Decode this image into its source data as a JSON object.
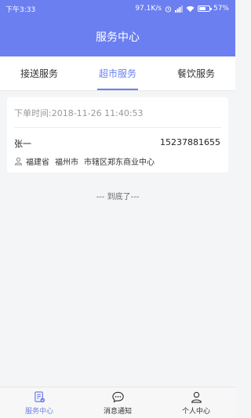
{
  "statusbar": {
    "time": "下午3:33",
    "network_speed": "97.1K/s",
    "battery": "57%",
    "battery_level": 0.57
  },
  "header": {
    "title": "服务中心"
  },
  "tabs": [
    {
      "label": "接送服务",
      "active": false
    },
    {
      "label": "超市服务",
      "active": true
    },
    {
      "label": "餐饮服务",
      "active": false
    }
  ],
  "order": {
    "time_label": "下单时间:2018-11-26 11:40:53",
    "name": "张一",
    "phone": "15237881655",
    "address": {
      "province": "福建省",
      "city": "福州市",
      "district_detail": "市辖区郑东商业中心"
    }
  },
  "list_end_text": "--- 到底了---",
  "bottom_nav": [
    {
      "label": "服务中心",
      "icon": "service-document-icon",
      "active": true
    },
    {
      "label": "消息通知",
      "icon": "message-bubble-icon",
      "active": false
    },
    {
      "label": "个人中心",
      "icon": "person-icon",
      "active": false
    }
  ],
  "colors": {
    "accent": "#6b7ff0",
    "background": "#f4f5f7"
  }
}
